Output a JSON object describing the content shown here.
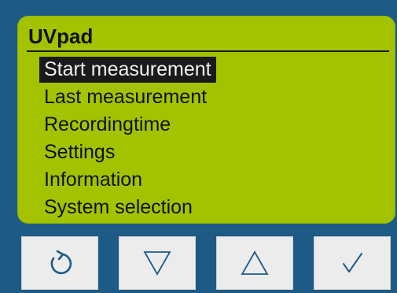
{
  "screen": {
    "title": "UVpad",
    "menu": [
      {
        "label": "Start measurement",
        "selected": true
      },
      {
        "label": "Last measurement",
        "selected": false
      },
      {
        "label": "Recordingtime",
        "selected": false
      },
      {
        "label": "Settings",
        "selected": false
      },
      {
        "label": "Information",
        "selected": false
      },
      {
        "label": "System selection",
        "selected": false
      }
    ]
  },
  "buttons": [
    {
      "icon": "back-arrow-icon"
    },
    {
      "icon": "triangle-down-icon"
    },
    {
      "icon": "triangle-up-icon"
    },
    {
      "icon": "checkmark-icon"
    }
  ],
  "colors": {
    "device": "#1e5a86",
    "lcd": "#a3c300",
    "selection": "#1a1a1a",
    "button": "#ececec",
    "icon": "#1e5a86"
  }
}
